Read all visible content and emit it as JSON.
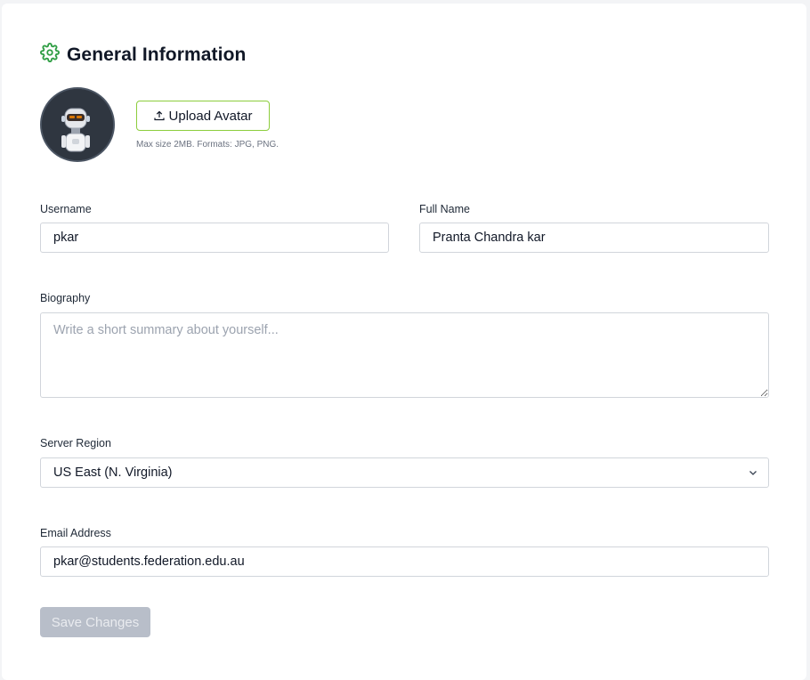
{
  "section": {
    "title": "General Information",
    "icon": "gear-icon",
    "accent_color": "#2f9e44"
  },
  "avatar": {
    "image": "robot-avatar",
    "upload_label": "Upload Avatar",
    "upload_icon": "upload-icon",
    "hint": "Max size 2MB. Formats: JPG, PNG."
  },
  "form": {
    "username": {
      "label": "Username",
      "value": "pkar"
    },
    "full_name": {
      "label": "Full Name",
      "value": "Pranta Chandra kar"
    },
    "biography": {
      "label": "Biography",
      "value": "",
      "placeholder": "Write a short summary about yourself..."
    },
    "server_region": {
      "label": "Server Region",
      "value": "US East (N. Virginia)"
    },
    "email": {
      "label": "Email Address",
      "value": "pkar@students.federation.edu.au"
    }
  },
  "actions": {
    "save_label": "Save Changes",
    "save_disabled": true
  },
  "colors": {
    "upload_border": "#8ccd3c",
    "save_bg": "#b8bec9"
  }
}
